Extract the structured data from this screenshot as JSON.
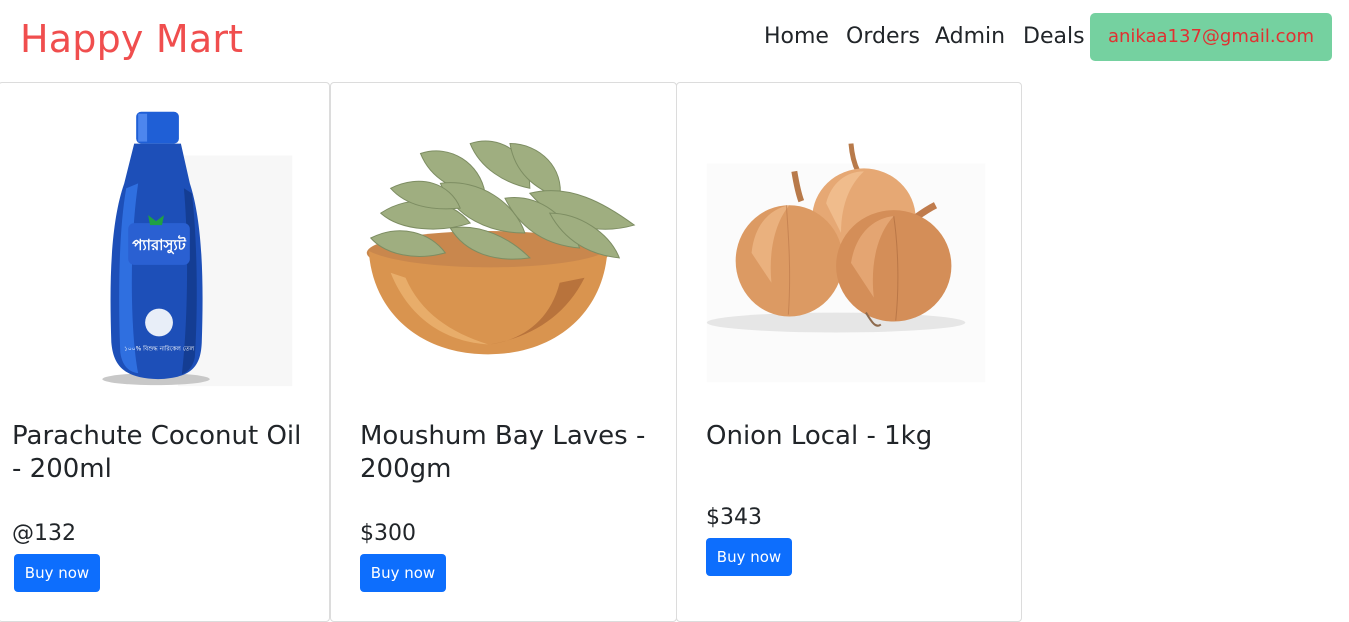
{
  "brand": "Happy Mart",
  "nav": {
    "home": "Home",
    "orders": "Orders",
    "admin": "Admin",
    "deals": "Deals",
    "user_email": "anikaa137@gmail.com"
  },
  "colors": {
    "brand": "#f04e4e",
    "user_button_bg": "#75d1a0",
    "user_button_text": "#e03131",
    "buy_button": "#0d6efd"
  },
  "products": [
    {
      "title": "Parachute Coconut Oil - 200ml",
      "price": "@132",
      "button": "Buy now",
      "image": "coconut-oil-bottle-image"
    },
    {
      "title": "Moushum Bay Laves - 200gm",
      "price": "$300",
      "button": "Buy now",
      "image": "bay-leaves-bowl-image"
    },
    {
      "title": "Onion Local - 1kg",
      "price": "$343",
      "button": "Buy now",
      "image": "onions-image"
    }
  ]
}
